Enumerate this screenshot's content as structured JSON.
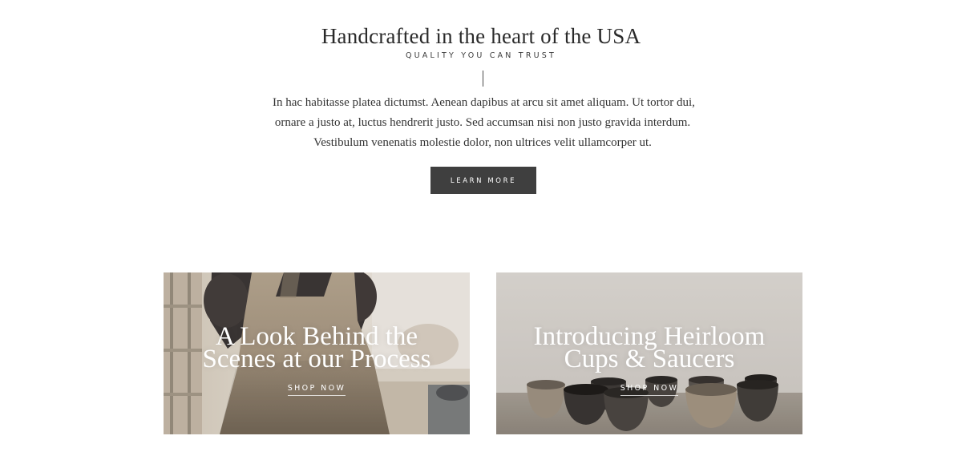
{
  "intro": {
    "headline": "Handcrafted in the heart of the USA",
    "kicker": "QUALITY YOU CAN TRUST",
    "body_lines": [
      "In hac habitasse platea dictumst. Aenean dapibus at arcu sit amet aliquam. Ut tortor dui,",
      "ornare a justo at, luctus hendrerit justo. Sed accumsan nisi non justo gravida interdum.",
      "Vestibulum venenatis molestie dolor, non ultrices velit ullamcorper ut."
    ],
    "cta_label": "LEARN MORE"
  },
  "cards": [
    {
      "title_lines": [
        "A Look Behind the",
        "Scenes at our Process"
      ],
      "link_label": "SHOP NOW"
    },
    {
      "title_lines": [
        "Introducing Heirloom",
        "Cups & Saucers"
      ],
      "link_label": "SHOP NOW"
    }
  ],
  "colors": {
    "text": "#2a2a2a",
    "button_bg": "#3f3f3f",
    "button_text": "#ffffff",
    "overlay_text": "#ffffff"
  }
}
